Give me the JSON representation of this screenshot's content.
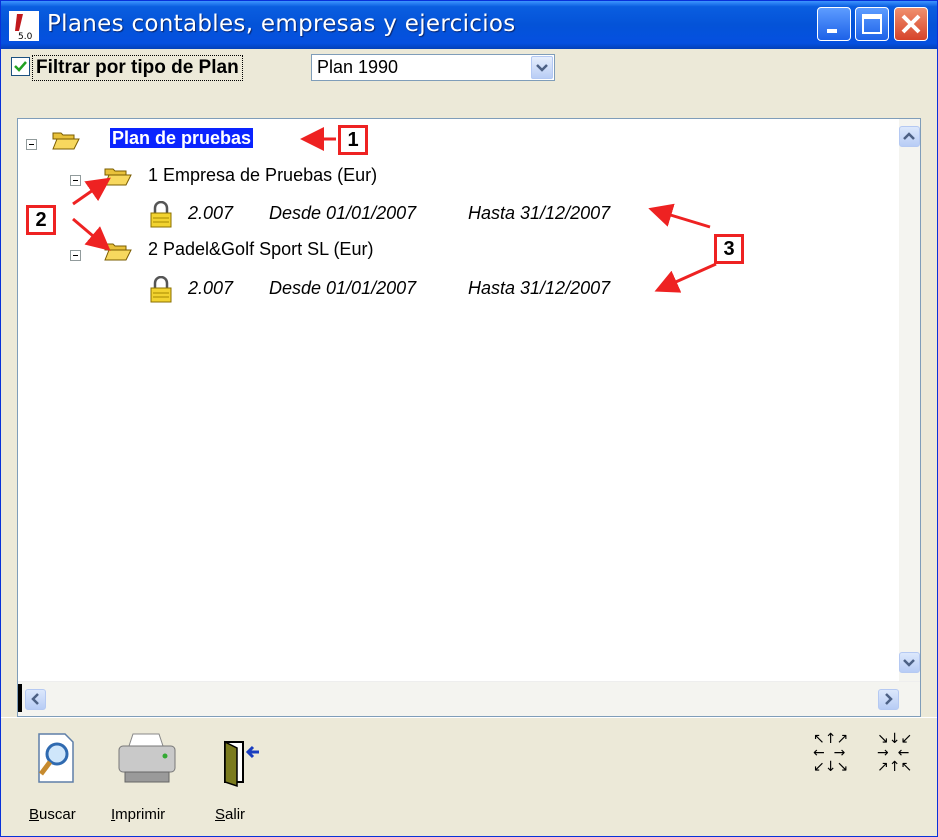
{
  "window": {
    "title": "Planes contables, empresas y ejercicios",
    "app_icon_version": "5.0",
    "controls": [
      "minimize-icon",
      "maximize-icon",
      "close-icon"
    ]
  },
  "filter": {
    "checked": true,
    "label": "Filtrar por tipo de Plan",
    "selected_plan": "Plan 1990"
  },
  "tree": {
    "root": {
      "label": "Plan de pruebas",
      "expanded": true,
      "selected": true
    },
    "companies": [
      {
        "label": "1 Empresa de Pruebas (Eur)",
        "expanded": true,
        "exercise": {
          "year": "2.007",
          "desde": "Desde 01/01/2007",
          "hasta": "Hasta 31/12/2007"
        }
      },
      {
        "label": "2 Padel&Golf Sport SL (Eur)",
        "expanded": true,
        "exercise": {
          "year": "2.007",
          "desde": "Desde 01/01/2007",
          "hasta": "Hasta 31/12/2007"
        }
      }
    ]
  },
  "annotations": [
    "1",
    "2",
    "3"
  ],
  "toolbar": {
    "buscar": "Buscar",
    "imprimir": "Imprimir",
    "salir": "Salir"
  },
  "colors": {
    "titlebar": "#0453d8",
    "selection": "#0a24ff",
    "annotation": "#e22222",
    "folder": "#f7d85e"
  }
}
